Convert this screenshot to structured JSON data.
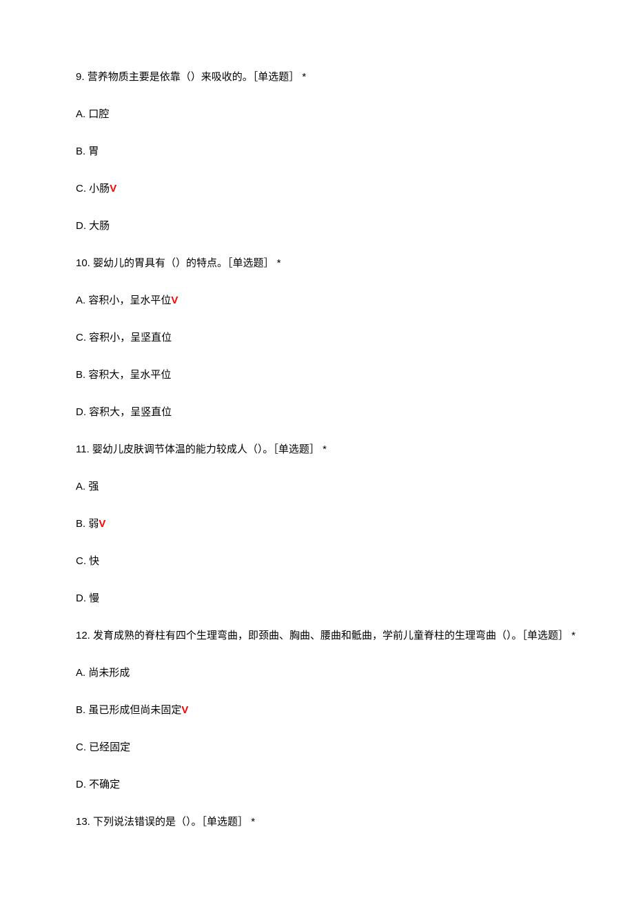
{
  "questions": [
    {
      "num": "9.",
      "stem": "营养物质主要是依靠（）来吸收的。［单选题］ *",
      "options": [
        {
          "label": "A.",
          "text": "口腔",
          "correct": false
        },
        {
          "label": "B.",
          "text": "胃",
          "correct": false
        },
        {
          "label": "C.",
          "text": "小肠",
          "correct": true
        },
        {
          "label": "D.",
          "text": "大肠",
          "correct": false
        }
      ]
    },
    {
      "num": "10.",
      "stem": "婴幼儿的胃具有（）的特点。［单选题］ *",
      "options": [
        {
          "label": "A.",
          "text": "容积小，呈水平位",
          "correct": true
        },
        {
          "label": "C.",
          "text": "容积小，呈坚直位",
          "correct": false
        },
        {
          "label": "B.",
          "text": "容积大，呈水平位",
          "correct": false
        },
        {
          "label": "D.",
          "text": "容积大，呈竖直位",
          "correct": false
        }
      ]
    },
    {
      "num": "11.",
      "stem": "婴幼儿皮肤调节体温的能力较成人（）。［单选题］ *",
      "options": [
        {
          "label": "A.",
          "text": "强",
          "correct": false
        },
        {
          "label": "B.",
          "text": "弱",
          "correct": true
        },
        {
          "label": "C.",
          "text": "快",
          "correct": false
        },
        {
          "label": "D.",
          "text": "慢",
          "correct": false
        }
      ]
    },
    {
      "num": "12.",
      "stem": "发育成熟的脊柱有四个生理弯曲，即颈曲、胸曲、腰曲和骶曲，学前儿童脊柱的生理弯曲（）。［单选题］ *",
      "options": [
        {
          "label": "A.",
          "text": "尚未形成",
          "correct": false
        },
        {
          "label": "B.",
          "text": "虽已形成但尚未固定",
          "correct": true
        },
        {
          "label": "C.",
          "text": "已经固定",
          "correct": false
        },
        {
          "label": "D.",
          "text": "不确定",
          "correct": false
        }
      ]
    },
    {
      "num": "13.",
      "stem": "下列说法错误的是（）。［单选题］ *",
      "options": []
    }
  ],
  "checkmark": "V"
}
